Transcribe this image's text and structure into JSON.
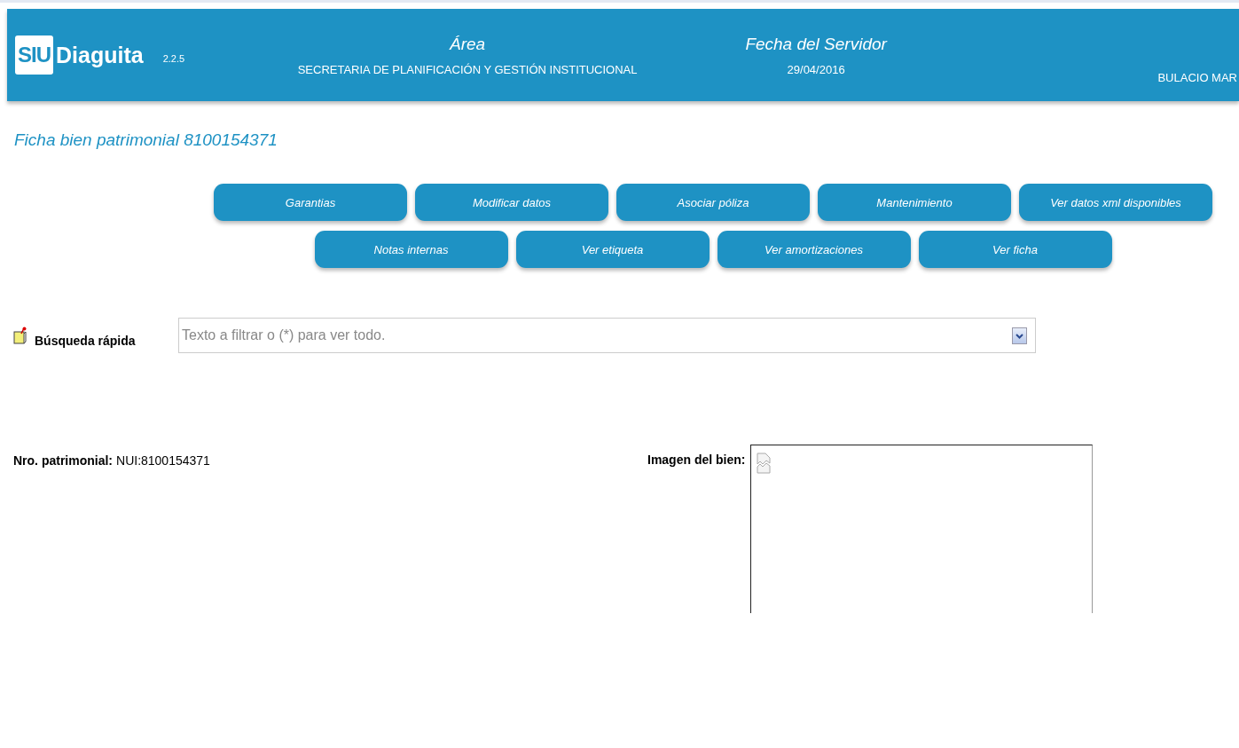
{
  "header": {
    "logo": {
      "mark": "SIU",
      "name": "Diaguita"
    },
    "version": "2.2.5",
    "area": {
      "label": "Área",
      "value": "SECRETARIA DE PLANIFICACIÓN Y GESTIÓN INSTITUCIONAL"
    },
    "server_date": {
      "label": "Fecha del Servidor",
      "value": "29/04/2016"
    },
    "user": "BULACIO MAR"
  },
  "title": "Ficha bien patrimonial 8100154371",
  "button_rows": [
    [
      "Garantias",
      "Modificar datos",
      "Asociar póliza",
      "Mantenimiento",
      "Ver datos xml disponibles"
    ],
    [
      "Notas internas",
      "Ver etiqueta",
      "Ver amortizaciones",
      "Ver ficha"
    ]
  ],
  "quick_search": {
    "label": "Búsqueda rápida",
    "placeholder": "Texto a filtrar o (*) para ver todo."
  },
  "patrimonial_number": {
    "label": "Nro. patrimonial:",
    "value": "NUI:8100154371"
  },
  "image": {
    "label": "Imagen del bien:"
  }
}
